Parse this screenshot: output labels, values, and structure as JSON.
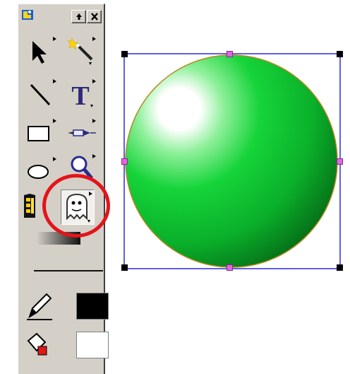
{
  "palette": {
    "title_bar": {
      "app_icon": "app-logo-icon",
      "buttons": [
        {
          "name": "dock-button",
          "icon": "up-arrow-icon"
        },
        {
          "name": "close-button",
          "icon": "close-icon"
        }
      ]
    },
    "tools": [
      {
        "name": "tool-select",
        "icon": "arrow-pointer-icon",
        "flyout": true
      },
      {
        "name": "tool-magic-wand",
        "icon": "magic-wand-icon",
        "flyout": true
      },
      {
        "name": "tool-line",
        "icon": "line-icon",
        "flyout": true
      },
      {
        "name": "tool-text",
        "icon": "text-T-icon",
        "label": "T",
        "flyout": true
      },
      {
        "name": "tool-rectangle",
        "icon": "rectangle-icon",
        "flyout": true
      },
      {
        "name": "tool-pen",
        "icon": "pen-nib-icon",
        "flyout": true
      },
      {
        "name": "tool-ellipse",
        "icon": "ellipse-icon",
        "flyout": true
      },
      {
        "name": "tool-zoom",
        "icon": "magnifier-icon",
        "flyout": true
      },
      {
        "name": "tool-film",
        "icon": "film-strip-icon",
        "flyout": false
      },
      {
        "name": "tool-ghost",
        "icon": "ghost-icon",
        "flyout": true,
        "selected": true,
        "highlighted": true
      },
      {
        "name": "tool-gradient",
        "icon": "gradient-icon",
        "flyout": false
      }
    ],
    "stroke_color": "#000000",
    "fill_color": "#ffffff",
    "highlight_color": "#e4141b"
  },
  "canvas": {
    "object": "green-sphere",
    "sphere_color": "#0fbf30",
    "selection_color": "#2a2ae0"
  }
}
